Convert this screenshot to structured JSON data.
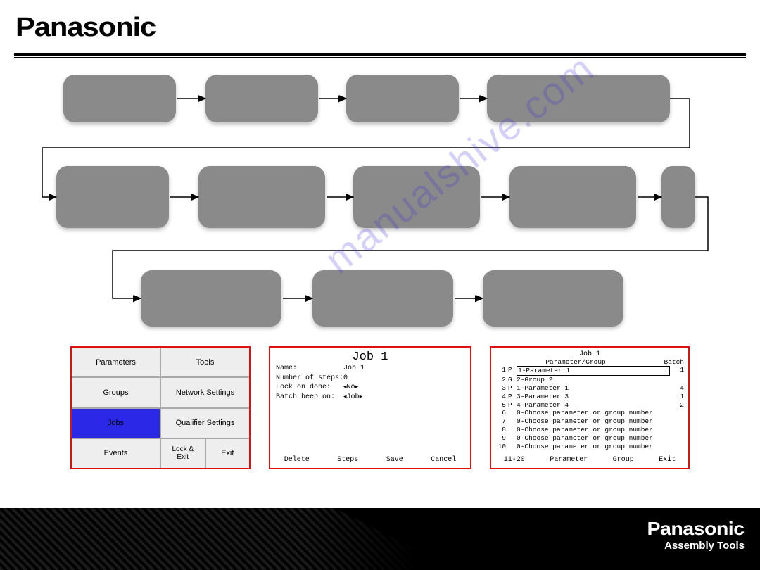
{
  "brand": "Panasonic",
  "footer_brand": "Panasonic",
  "footer_sub": "Assembly Tools",
  "watermark": "manualshive.com",
  "menu": {
    "cells": [
      "Parameters",
      "Tools",
      "Groups",
      "Network Settings",
      "Jobs",
      "Qualifier Settings",
      "Events"
    ],
    "lock_exit": "Lock &\nExit",
    "exit": "Exit",
    "selected_index": 4
  },
  "job": {
    "title": "Job 1",
    "fields": [
      {
        "label": "Name:",
        "value": "Job 1"
      },
      {
        "label": "Number of steps:",
        "value": "0"
      },
      {
        "label": "Lock on done:",
        "value": "◂No▸"
      },
      {
        "label": "Batch beep on:",
        "value": "◂Job▸"
      }
    ],
    "footer": [
      "Delete",
      "Steps",
      "Save",
      "Cancel"
    ]
  },
  "params": {
    "title": "Job 1",
    "sub": "Parameter/Group",
    "batch_hdr": "Batch",
    "rows": [
      {
        "n": "1",
        "t": "P",
        "d": "1-Parameter 1",
        "b": "1",
        "sel": true
      },
      {
        "n": "2",
        "t": "G",
        "d": "2-Group 2",
        "b": ""
      },
      {
        "n": "3",
        "t": "P",
        "d": "1-Parameter 1",
        "b": "4"
      },
      {
        "n": "4",
        "t": "P",
        "d": "3-Parameter 3",
        "b": "1"
      },
      {
        "n": "5",
        "t": "P",
        "d": "4-Parameter 4",
        "b": "2"
      },
      {
        "n": "6",
        "t": "",
        "d": "0-Choose parameter or group number",
        "b": ""
      },
      {
        "n": "7",
        "t": "",
        "d": "0-Choose parameter or group number",
        "b": ""
      },
      {
        "n": "8",
        "t": "",
        "d": "0-Choose parameter or group number",
        "b": ""
      },
      {
        "n": "9",
        "t": "",
        "d": "0-Choose parameter or group number",
        "b": ""
      },
      {
        "n": "10",
        "t": "",
        "d": "0-Choose parameter or group number",
        "b": ""
      }
    ],
    "footer": [
      "11-20",
      "Parameter",
      "Group",
      "Exit"
    ]
  }
}
